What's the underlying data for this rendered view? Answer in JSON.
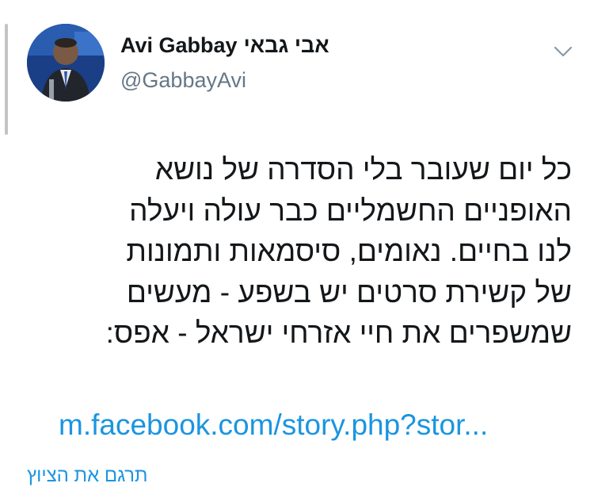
{
  "author": {
    "display_name": "Avi Gabbay",
    "display_name_hebrew": "אבי גבאי",
    "handle": "@GabbayAvi"
  },
  "icons": {
    "avatar": "profile-photo",
    "menu": "chevron-down-icon"
  },
  "tweet": {
    "lines": [
      "כל יום שעובר בלי הסדרה של נושא",
      "האופניים החשמליים כבר עולה ויעלה",
      "לנו בחיים. נאומים, סיסמאות ותמונות",
      "של קשירת סרטים יש בשפע - מעשים",
      "שמשפרים את חיי אזרחי ישראל - אפס:"
    ],
    "link": "m.facebook.com/story.php?stor..."
  },
  "translate_label": "תרגם את הציוץ",
  "colors": {
    "link": "#1b95e0",
    "secondary_text": "#657786",
    "primary_text": "#14171a"
  }
}
